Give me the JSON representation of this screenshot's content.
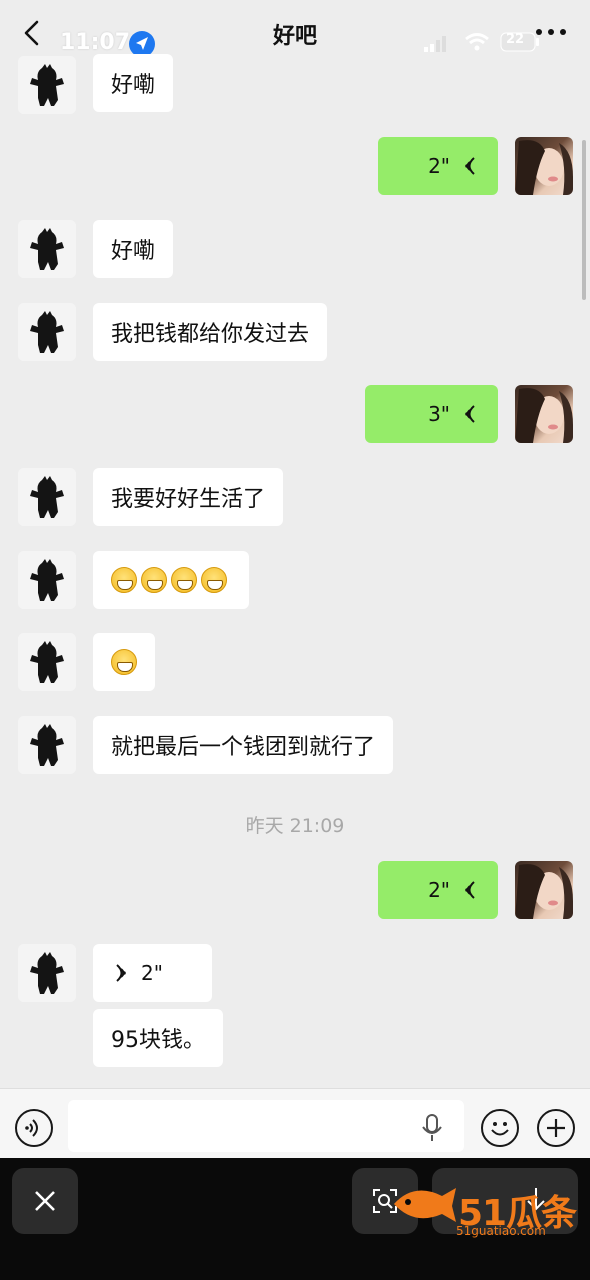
{
  "header": {
    "title": "好吧",
    "status_time": "11:07",
    "battery": "22"
  },
  "messages": [
    {
      "side": "left",
      "type": "text",
      "text": "好嘞"
    },
    {
      "side": "right",
      "type": "voice",
      "duration": "2\""
    },
    {
      "side": "left",
      "type": "text",
      "text": "好嘞"
    },
    {
      "side": "left",
      "type": "text",
      "text": "我把钱都给你发过去"
    },
    {
      "side": "right",
      "type": "voice",
      "duration": "3\""
    },
    {
      "side": "left",
      "type": "text",
      "text": "我要好好生活了"
    },
    {
      "side": "left",
      "type": "emoji",
      "count": 4,
      "emoji": "grinning-face"
    },
    {
      "side": "left",
      "type": "emoji",
      "count": 1,
      "emoji": "grinning-face"
    },
    {
      "side": "left",
      "type": "text",
      "text": "就把最后一个钱团到就行了"
    },
    {
      "side": "right",
      "type": "voice",
      "duration": "2\""
    },
    {
      "side": "left",
      "type": "voice",
      "duration": "2\""
    },
    {
      "side": "left",
      "type": "text",
      "text": "95块钱。"
    }
  ],
  "timestamp": "昨天 21:09",
  "input": {
    "placeholder": ""
  },
  "watermark": {
    "logo": "51瓜条",
    "site": "51guatiao.com"
  },
  "colors": {
    "background": "#ededed",
    "sent_bubble": "#95ec69",
    "received_bubble": "#ffffff",
    "accent": "#f07a1a"
  }
}
